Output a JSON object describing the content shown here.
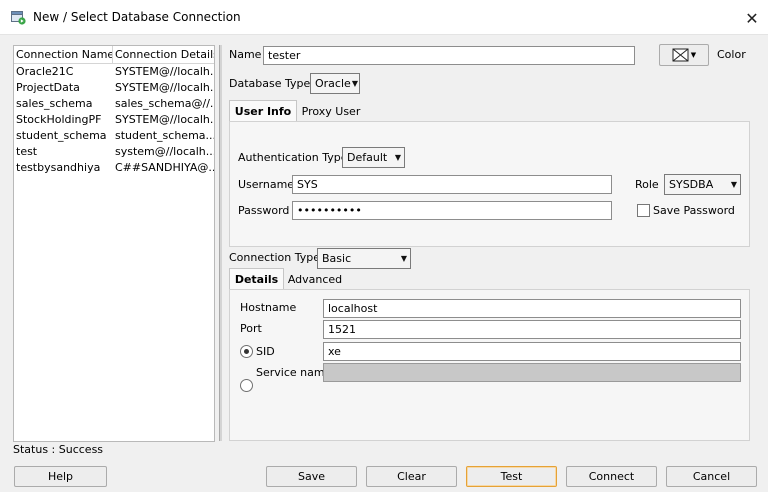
{
  "window": {
    "title": "New / Select Database Connection",
    "close_glyph": "✕"
  },
  "connections": {
    "headers": [
      "Connection Name",
      "Connection Details"
    ],
    "rows": [
      {
        "name": "Oracle21C",
        "details": "SYSTEM@//localh..."
      },
      {
        "name": "ProjectData",
        "details": "SYSTEM@//localh..."
      },
      {
        "name": "sales_schema",
        "details": "sales_schema@//..."
      },
      {
        "name": "StockHoldingPF",
        "details": "SYSTEM@//localh..."
      },
      {
        "name": "student_schema",
        "details": "student_schema..."
      },
      {
        "name": "test",
        "details": "system@//localh..."
      },
      {
        "name": "testbysandhiya",
        "details": "C##SANDHIYA@..."
      }
    ]
  },
  "status": "Status : Success",
  "form": {
    "name_label": "Name",
    "name_value": "tester",
    "color_label": "Color",
    "db_type_label": "Database Type",
    "db_type_value": "Oracle",
    "tabs_top": [
      "User Info",
      "Proxy User"
    ],
    "auth_type_label": "Authentication Type",
    "auth_type_value": "Default",
    "username_label": "Username",
    "username_value": "SYS",
    "role_label": "Role",
    "role_value": "SYSDBA",
    "password_label": "Password",
    "password_value": "••••••••••",
    "save_password_label": "Save Password",
    "conn_type_label": "Connection Type",
    "conn_type_value": "Basic",
    "tabs_bottom": [
      "Details",
      "Advanced"
    ],
    "hostname_label": "Hostname",
    "hostname_value": "localhost",
    "port_label": "Port",
    "port_value": "1521",
    "sid_label": "SID",
    "sid_value": "xe",
    "service_label": "Service name",
    "service_value": ""
  },
  "buttons": {
    "help": "Help",
    "save": "Save",
    "clear": "Clear",
    "test": "Test",
    "connect": "Connect",
    "cancel": "Cancel"
  },
  "colors": {
    "focus_border": "#e6a236",
    "disabled_field": "#c8c8c8"
  }
}
